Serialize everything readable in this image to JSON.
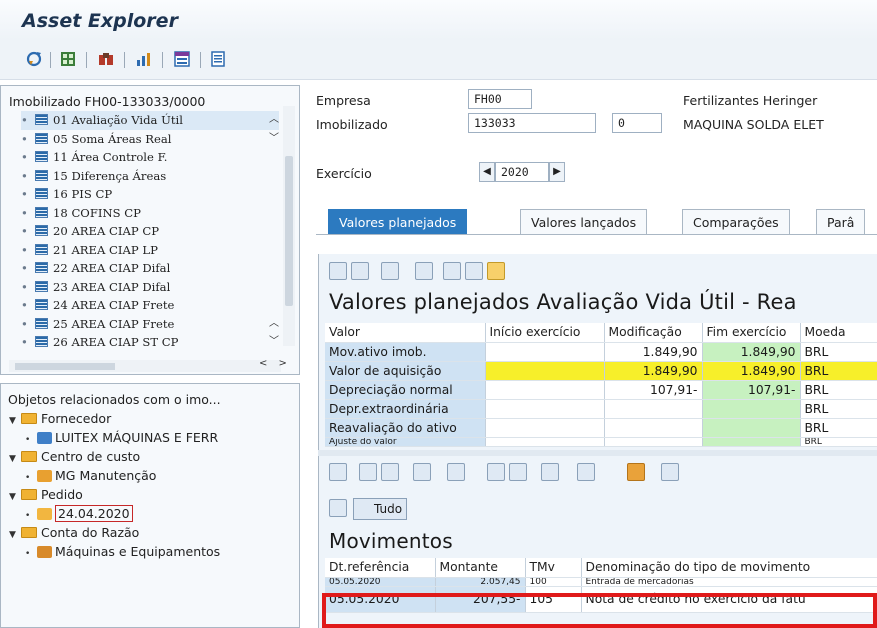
{
  "app": {
    "title": "Asset Explorer"
  },
  "toolbar": {
    "icons": [
      "refresh-icon",
      "grid-icon",
      "binoculars-icon",
      "chart-icon",
      "layout-icon",
      "list-icon"
    ]
  },
  "tree": {
    "header": "Imobilizado FH00-133033/0000",
    "items": [
      {
        "label": "01 Avaliação Vida Útil",
        "selected": true
      },
      {
        "label": "05 Soma Áreas Real"
      },
      {
        "label": "11 Área Controle F."
      },
      {
        "label": "15 Diferença Áreas"
      },
      {
        "label": "16 PIS CP"
      },
      {
        "label": "18 COFINS CP"
      },
      {
        "label": "20 AREA CIAP CP"
      },
      {
        "label": "21 AREA CIAP LP"
      },
      {
        "label": "22 AREA CIAP Difal"
      },
      {
        "label": "23 AREA CIAP Difal"
      },
      {
        "label": "24 AREA CIAP Frete"
      },
      {
        "label": "25 AREA CIAP Frete"
      },
      {
        "label": "26 AREA CIAP ST CP"
      }
    ]
  },
  "related": {
    "header": "Objetos relacionados com o imo...",
    "fornecedor": "Fornecedor",
    "fornecedor_item": "LUITEX MÁQUINAS E FERR",
    "centro": "Centro de custo",
    "centro_item": "MG Manutenção",
    "pedido": "Pedido",
    "pedido_item": "24.04.2020",
    "conta": "Conta do Razão",
    "conta_item": "Máquinas e Equipamentos"
  },
  "header_form": {
    "empresa_label": "Empresa",
    "empresa_value": "FH00",
    "empresa_name": "Fertilizantes Heringer",
    "imob_label": "Imobilizado",
    "imob_value": "133033",
    "imob_sub": "0",
    "imob_name": "MAQUINA SOLDA ELET",
    "exercicio_label": "Exercício",
    "exercicio_value": "2020"
  },
  "tabs": [
    "Valores planejados",
    "Valores lançados",
    "Comparações",
    "Parâ"
  ],
  "planned": {
    "title": "Valores planejados Avaliação Vida Útil - Rea",
    "columns": [
      "Valor",
      "Início exercício",
      "Modificação",
      "Fim exercício",
      "Moeda"
    ],
    "rows": [
      {
        "label": "Mov.ativo imob.",
        "inicio": "",
        "mod": "1.849,90",
        "fim": "1.849,90",
        "moeda": "BRL"
      },
      {
        "label": "Valor de aquisição",
        "inicio": "",
        "mod": "1.849,90",
        "fim": "1.849,90",
        "moeda": "BRL"
      },
      {
        "label": "Depreciação normal",
        "inicio": "",
        "mod": "107,91-",
        "fim": "107,91-",
        "moeda": "BRL"
      },
      {
        "label": "Depr.extraordinária",
        "inicio": "",
        "mod": "",
        "fim": "",
        "moeda": "BRL"
      },
      {
        "label": "Reavaliação do ativo",
        "inicio": "",
        "mod": "",
        "fim": "",
        "moeda": "BRL"
      },
      {
        "label": "Ajuste do valor",
        "inicio": "",
        "mod": "",
        "fim": "",
        "moeda": "BRL"
      }
    ]
  },
  "movements": {
    "tudo_label": "Tudo",
    "title": "Movimentos",
    "columns": [
      "Dt.referência",
      "Montante",
      "TMv",
      "Denominação do tipo de movimento"
    ],
    "rows": [
      {
        "date": "05.05.2020",
        "amount": "2.057,45",
        "tmv": "100",
        "desc": "Entrada de mercadorias"
      },
      {
        "date": "05.05.2020",
        "amount": "207,55-",
        "tmv": "105",
        "desc": "Nota de crédito no exercício da fatu"
      }
    ]
  }
}
